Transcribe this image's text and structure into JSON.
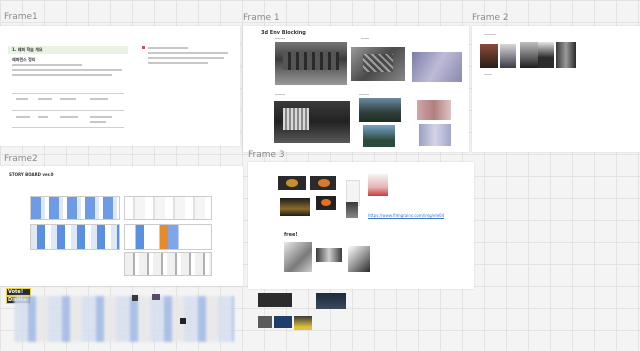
{
  "frames": {
    "frame1_left": {
      "label": "Frame1",
      "doc_title": "1. 레퍼 학습 개요",
      "doc_heading": "레퍼런스 정리",
      "table_headers": [
        "",
        "항목",
        "내용",
        "비고",
        "메모"
      ]
    },
    "frame1_center": {
      "label": "Frame 1",
      "title": "3d Env Blocking"
    },
    "frame2_right": {
      "label": "Frame 2"
    },
    "frame2_left": {
      "label": "Frame2",
      "title": "STORY BOARD ver.0"
    },
    "frame3": {
      "label": "Frame 3",
      "link": "https://www.filmgrains.com/img/ele04",
      "subtitle": "free!"
    }
  },
  "floating_tags": [
    "Vote!",
    "Dislike!"
  ],
  "colors": {
    "canvas": "#f4f4f4",
    "grid": "#e3e3e3",
    "storyboard_blue": "#5b8fe0",
    "accent_orange": "#e58b2a",
    "link_blue": "#3a78c8"
  }
}
